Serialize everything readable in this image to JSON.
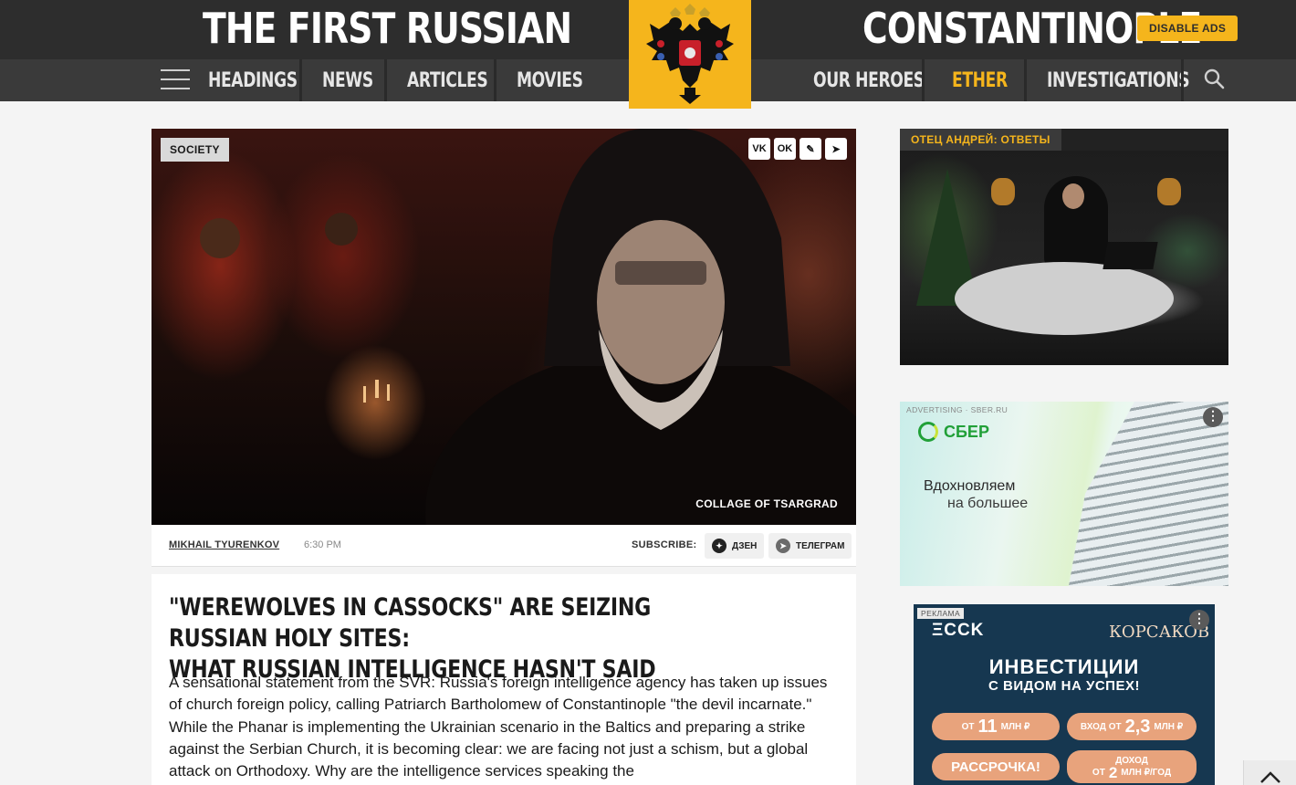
{
  "header": {
    "title_left": "THE FIRST RUSSIAN",
    "title_right": "CONSTANTINOPLE",
    "disable_ads": "DISABLE ADS",
    "logo_icon": "double-headed-eagle-icon",
    "accent_color": "#f5b51c"
  },
  "nav": {
    "left": [
      "HEADINGS",
      "NEWS",
      "ARTICLES",
      "MOVIES"
    ],
    "right": [
      "OUR HEROES",
      "ETHER",
      "INVESTIGATIONS"
    ],
    "active": "ETHER"
  },
  "hero": {
    "category": "SOCIETY",
    "caption": "COLLAGE OF TSARGRAD",
    "share": [
      "VK",
      "OK",
      "✎",
      "➤"
    ]
  },
  "meta": {
    "author": "MIKHAIL TYURENKOV",
    "time": "6:30 PM",
    "subscribe_label": "SUBSCRIBE:",
    "dzen": "ДЗЕН",
    "telegram": "ТЕЛЕГРАМ"
  },
  "article": {
    "title": "\"WEREWOLVES IN CASSOCKS\" ARE SEIZING RUSSIAN HOLY SITES:\nWHAT RUSSIAN INTELLIGENCE HASN'T SAID",
    "lead": "A sensational statement from the SVR: Russia's foreign intelligence agency has taken up issues of church foreign policy, calling Patriarch Bartholomew of Constantinople \"the devil incarnate.\" While the Phanar is implementing the Ukrainian scenario in the Baltics and preparing a strike against the Serbian Church, it is becoming clear: we are facing not just a schism, but a global attack on Orthodoxy. Why are the intelligence services speaking the"
  },
  "sidebar": {
    "video_label": "ОТЕЦ АНДРЕЙ: ОТВЕТЫ",
    "ad1": {
      "label": "ADVERTISING · SBER.RU",
      "brand": "СБЕР",
      "line1": "Вдохновляем",
      "line2": "на большее"
    },
    "ad2": {
      "tag": "РЕКЛАМА",
      "brand": "ΞCCK",
      "brand2": "КОРСАКОВ",
      "head1": "ИНВЕСТИЦИИ",
      "head2": "С ВИДОМ НА УСПЕХ!",
      "pill1_pre": "ОТ",
      "pill1_num": "11",
      "pill1_post": "МЛН ₽",
      "pill2_pre": "ВХОД ОТ",
      "pill2_num": "2,3",
      "pill2_post": "МЛН ₽",
      "pill3": "РАССРОЧКА!",
      "pill4_top": "ДОХОД",
      "pill4_pre": "ОТ",
      "pill4_num": "2",
      "pill4_post": "МЛН ₽/ГОД"
    }
  }
}
